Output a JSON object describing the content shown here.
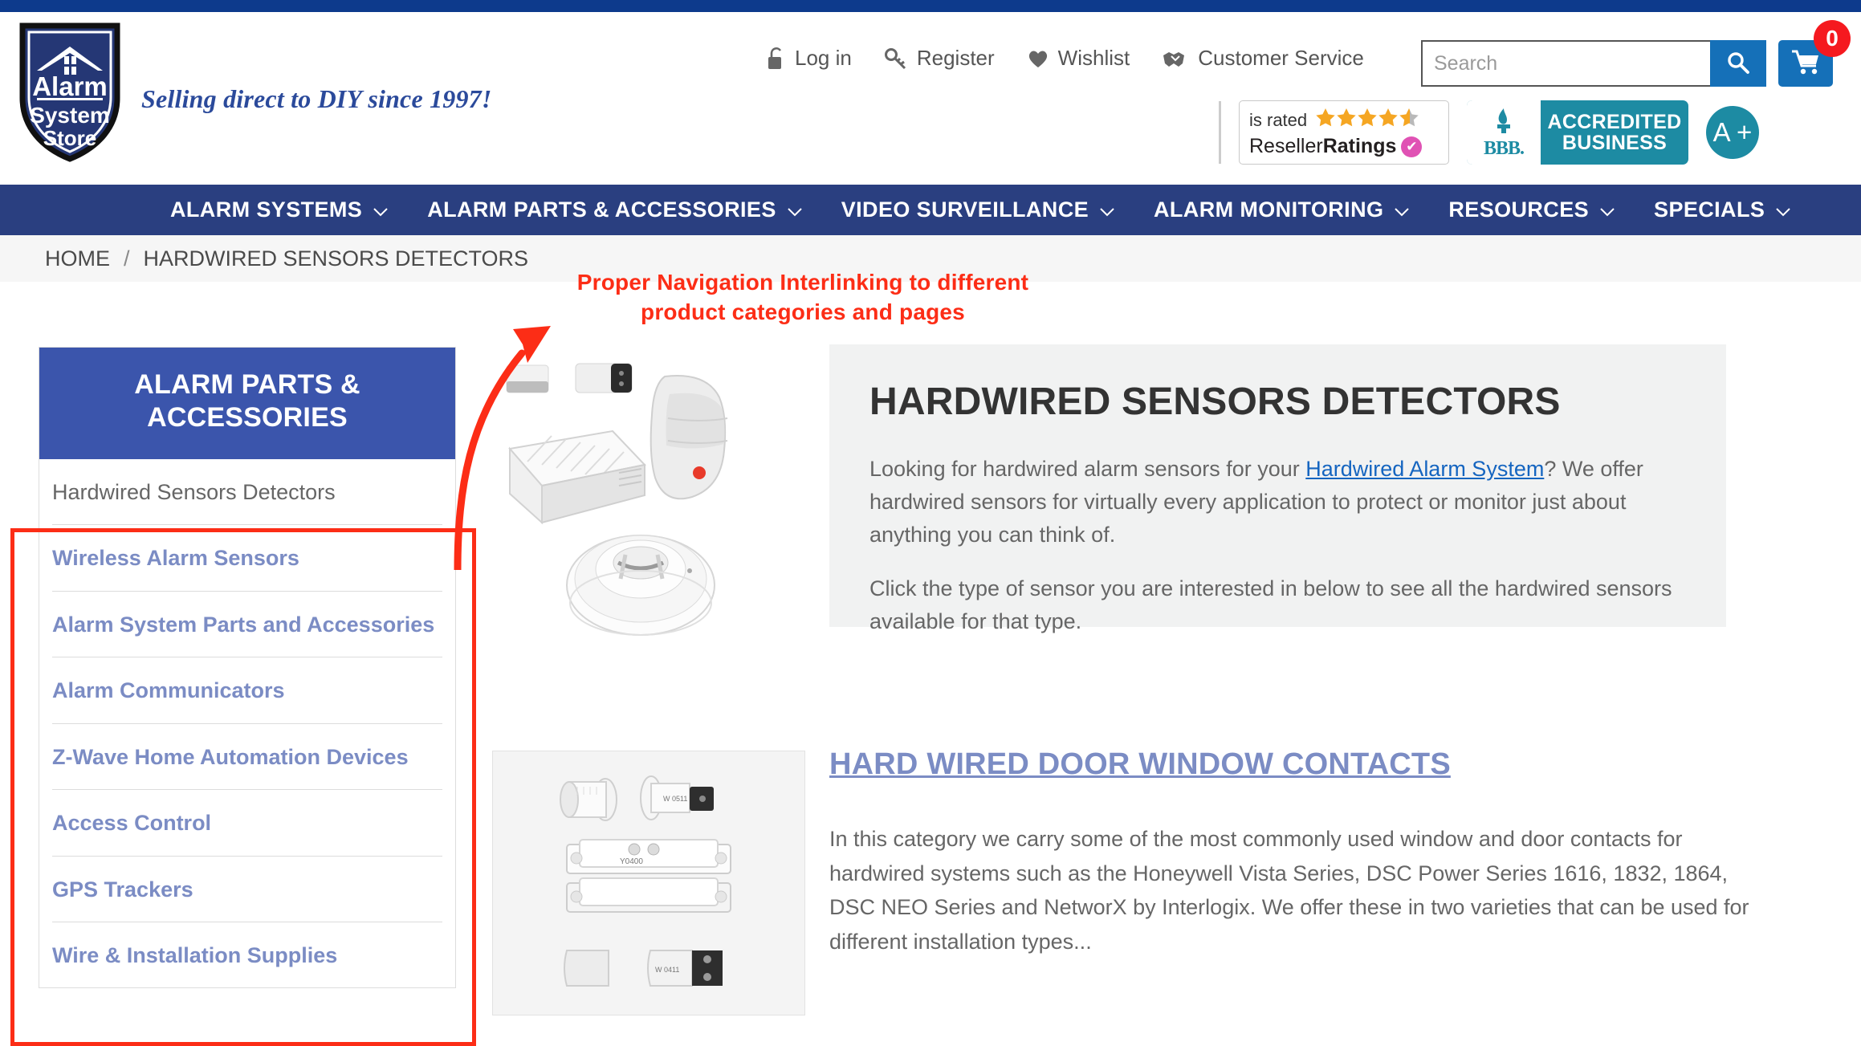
{
  "brand": {
    "logo_lines": [
      "Alarm",
      "System",
      "Store"
    ],
    "tagline": "Selling direct to DIY since 1997!"
  },
  "header": {
    "util_links": [
      {
        "label": "Log in",
        "icon": "unlock-icon"
      },
      {
        "label": "Register",
        "icon": "key-icon"
      },
      {
        "label": "Wishlist",
        "icon": "heart-icon"
      },
      {
        "label": "Customer Service",
        "icon": "handshake-icon"
      }
    ],
    "search": {
      "placeholder": "Search",
      "value": "",
      "button_icon": "search-icon"
    },
    "cart": {
      "icon": "cart-icon",
      "count": "0"
    },
    "badges": {
      "reseller_ratings": {
        "rated_label": "is rated",
        "stars": "★★★★★",
        "stars_filled": 4.5,
        "name_light": "Reseller",
        "name_bold": "Ratings",
        "check": "✔"
      },
      "bbb": {
        "mark": "BBB.",
        "line1": "ACCREDITED",
        "line2": "BUSINESS"
      },
      "rating_grade": "A +"
    }
  },
  "mainnav": {
    "items": [
      {
        "label": "ALARM SYSTEMS",
        "caret": "⌄"
      },
      {
        "label": "ALARM PARTS & ACCESSORIES",
        "caret": "⌄"
      },
      {
        "label": "VIDEO SURVEILLANCE",
        "caret": "⌄"
      },
      {
        "label": "ALARM MONITORING",
        "caret": "⌄"
      },
      {
        "label": "RESOURCES",
        "caret": "⌄"
      },
      {
        "label": "SPECIALS",
        "caret": "⌄"
      }
    ]
  },
  "breadcrumb": {
    "home": "HOME",
    "separator": "/",
    "current": "HARDWIRED SENSORS DETECTORS"
  },
  "annotation": {
    "text_line1": "Proper Navigation Interlinking to different",
    "text_line2": "product categories and pages",
    "color": "#fc2d16"
  },
  "sidebar": {
    "heading": "ALARM PARTS & ACCESSORIES",
    "items": [
      {
        "label": "Hardwired Sensors Detectors",
        "state": "current"
      },
      {
        "label": "Wireless Alarm Sensors",
        "state": "link"
      },
      {
        "label": "Alarm System Parts and Accessories",
        "state": "link"
      },
      {
        "label": "Alarm Communicators",
        "state": "link"
      },
      {
        "label": "Z-Wave Home Automation Devices",
        "state": "link"
      },
      {
        "label": "Access Control",
        "state": "link"
      },
      {
        "label": "GPS Trackers",
        "state": "link"
      },
      {
        "label": "Wire & Installation Supplies",
        "state": "link"
      }
    ]
  },
  "hero": {
    "image_alt": "hardwired-sensors-collage-image",
    "title": "HARDWIRED SENSORS DETECTORS",
    "paragraph1_pre": "Looking for hardwired alarm sensors for your ",
    "paragraph1_link": "Hardwired Alarm System",
    "paragraph1_post": "? We offer hardwired sensors for virtually every application to protect or monitor just about anything you can think of.",
    "paragraph2": "Click the type of sensor you are interested in below to see all the hardwired sensors available for that type."
  },
  "product_block": {
    "image_alt": "door-window-contacts-image",
    "title": "HARD WIRED DOOR WINDOW CONTACTS",
    "description": "In this category we carry some of the most commonly used window and door contacts for hardwired systems such as the Honeywell Vista Series, DSC Power Series 1616, 1832, 1864, DSC NEO Series and NetworX by Interlogix. We offer these in two varieties that can be used for different installation types..."
  },
  "colors": {
    "top_strip": "#0d3a8c",
    "nav_blue": "#2a3f80",
    "sidebar_head_blue": "#3b55ac",
    "accent_blue": "#1570b8",
    "link_blue": "#7b8cc4",
    "annotation_red": "#fc2d16",
    "badge_red": "#f5191f",
    "teal": "#1d8ba3"
  }
}
